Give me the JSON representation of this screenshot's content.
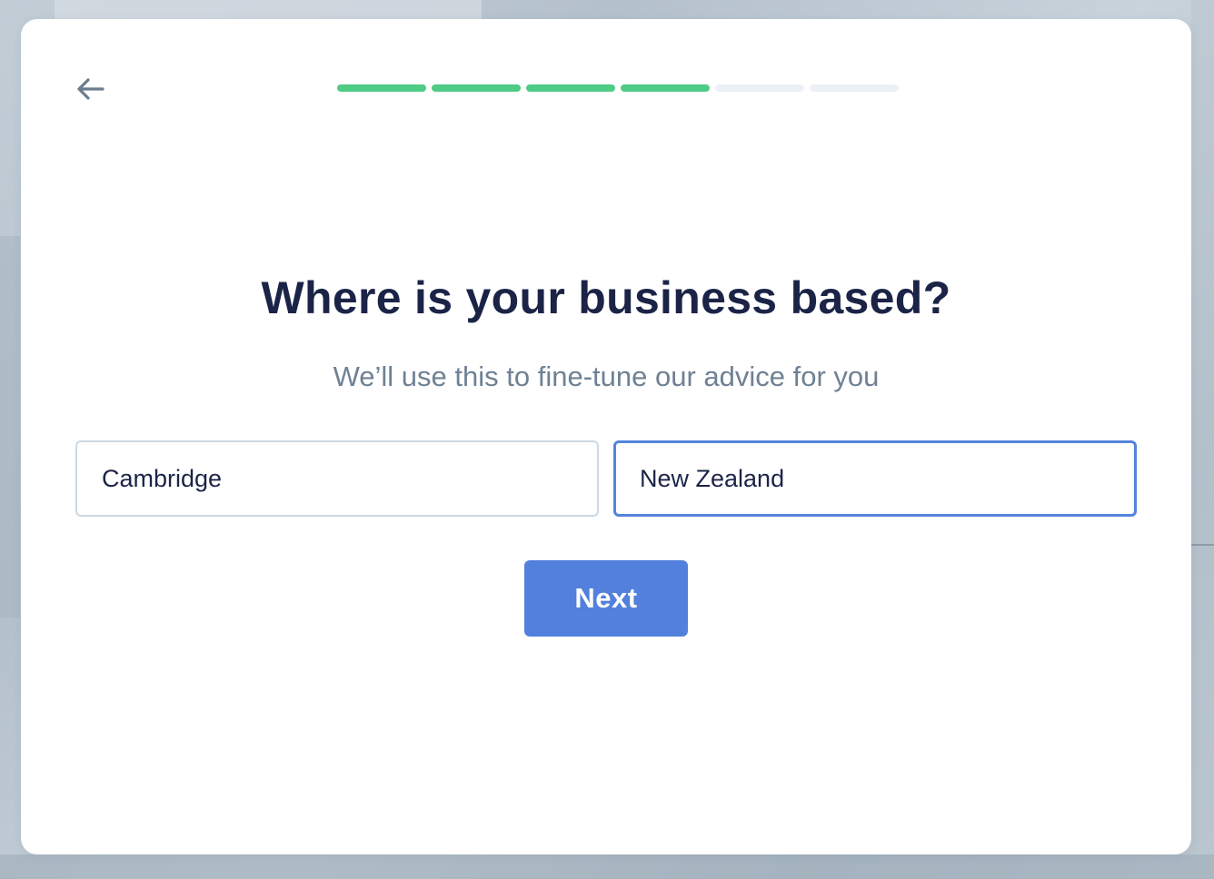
{
  "progress": {
    "steps_total": 6,
    "steps_completed": 4,
    "complete_color": "#4ecb84",
    "incomplete_color": "#edf1f5"
  },
  "header": {
    "back_icon": "arrow-left-icon"
  },
  "main": {
    "title": "Where is your business based?",
    "subtitle": "We’ll use this to fine-tune our advice for you"
  },
  "form": {
    "city_value": "Cambridge",
    "country_value": "New Zealand",
    "next_label": "Next",
    "accent_color": "#5280dc"
  }
}
